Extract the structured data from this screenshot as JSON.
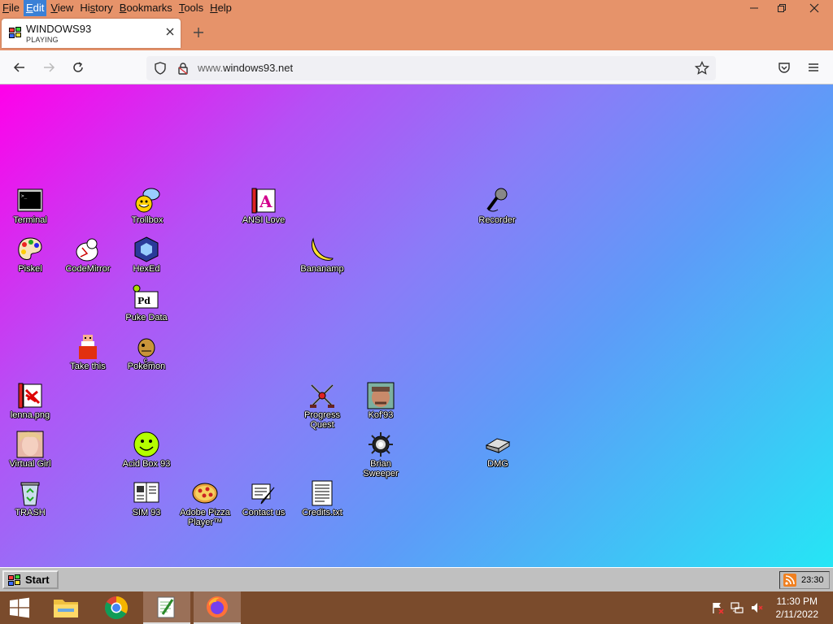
{
  "menu": [
    "File",
    "Edit",
    "View",
    "History",
    "Bookmarks",
    "Tools",
    "Help"
  ],
  "menu_mnemonic": [
    "F",
    "E",
    "V",
    "s",
    "B",
    "T",
    "H"
  ],
  "tab": {
    "title": "WINDOWS93",
    "subtitle": "PLAYING"
  },
  "url": {
    "prefix": "www.",
    "host": "windows93.net"
  },
  "desktop_icons": [
    {
      "name": "terminal",
      "label": "Terminal"
    },
    {
      "name": "trollbox",
      "label": "Trollbox"
    },
    {
      "name": "ansi-love",
      "label": "ANSI Love"
    },
    {
      "name": "recorder",
      "label": "Recorder"
    },
    {
      "name": "piskel",
      "label": "Piskel"
    },
    {
      "name": "codemirror",
      "label": "CodeMirror"
    },
    {
      "name": "hexed",
      "label": "HexEd"
    },
    {
      "name": "bananamp",
      "label": "Bananamp"
    },
    {
      "name": "puke-data",
      "label": "Puke Data"
    },
    {
      "name": "take-this",
      "label": "Take this"
    },
    {
      "name": "pokemon",
      "label": "Pokeͨ͡mon"
    },
    {
      "name": "lenna",
      "label": "lenna.png"
    },
    {
      "name": "progress-quest",
      "label": "Progress Quest"
    },
    {
      "name": "kof93",
      "label": "Kof'93"
    },
    {
      "name": "virtual-girl",
      "label": "Virtual Girl"
    },
    {
      "name": "acid-box",
      "label": "Acid Box 93"
    },
    {
      "name": "brian-sweeper",
      "label": "Brian Sweeper"
    },
    {
      "name": "dmg",
      "label": "DMG"
    },
    {
      "name": "trash",
      "label": "TRASH"
    },
    {
      "name": "sim93",
      "label": "SIM 93"
    },
    {
      "name": "adobe-pizza",
      "label": "Adobe Pizza Player™"
    },
    {
      "name": "contact-us",
      "label": "Contact us"
    },
    {
      "name": "credits",
      "label": "Credits.txt"
    }
  ],
  "w93_taskbar": {
    "start_label": "Start",
    "clock": "23:30"
  },
  "win_taskbar": {
    "time": "11:30 PM",
    "date": "2/11/2022"
  },
  "colors": {
    "titlebar": "#e6936a",
    "taskbar": "#7a4b2c",
    "gradient_start": "#ff00ea",
    "gradient_end": "#25e6f5"
  }
}
